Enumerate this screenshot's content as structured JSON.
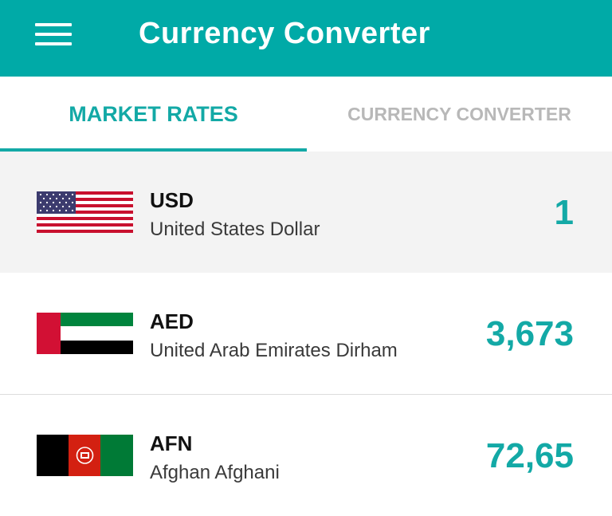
{
  "appbar": {
    "title": "Currency Converter",
    "menu_icon": "hamburger-menu-icon"
  },
  "tabs": [
    {
      "label": "MARKET RATES",
      "active": true
    },
    {
      "label": "CURRENCY CONVERTER",
      "active": false
    }
  ],
  "colors": {
    "primary": "#00aaa7",
    "accent": "#13a9a6",
    "inactive_tab": "#b8b8b8",
    "selected_row": "#f3f3f3"
  },
  "rates": [
    {
      "code": "USD",
      "name": "United States Dollar",
      "rate": "1",
      "flag_icon": "us-flag-icon"
    },
    {
      "code": "AED",
      "name": "United Arab Emirates Dirham",
      "rate": "3,673",
      "flag_icon": "uae-flag-icon"
    },
    {
      "code": "AFN",
      "name": "Afghan Afghani",
      "rate": "72,65",
      "flag_icon": "afghanistan-flag-icon"
    }
  ]
}
